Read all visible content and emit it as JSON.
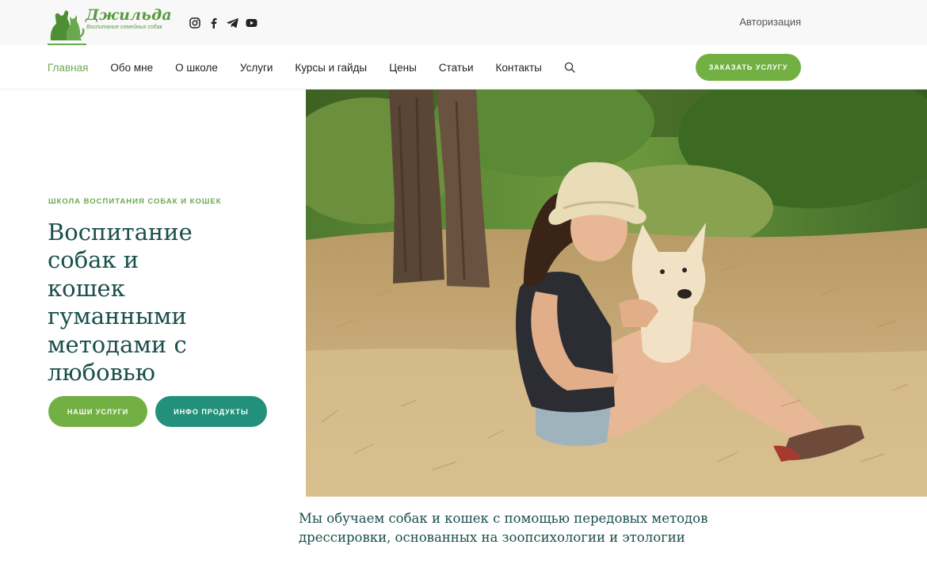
{
  "header": {
    "logo": {
      "name": "Джильда",
      "tagline": "Воспитание семейных собак"
    },
    "socials": [
      {
        "icon": "instagram-icon"
      },
      {
        "icon": "facebook-icon"
      },
      {
        "icon": "telegram-icon"
      },
      {
        "icon": "youtube-icon"
      }
    ],
    "auth_label": "Авторизация"
  },
  "nav": {
    "items": [
      {
        "label": "Главная",
        "active": true
      },
      {
        "label": "Обо мне"
      },
      {
        "label": "О школе"
      },
      {
        "label": "Услуги"
      },
      {
        "label": "Курсы и гайды"
      },
      {
        "label": "Цены"
      },
      {
        "label": "Статьи"
      },
      {
        "label": "Контакты"
      }
    ],
    "search_icon": "search-icon",
    "order_button": "ЗАКАЗАТЬ УСЛУГУ"
  },
  "hero": {
    "eyebrow": "ШКОЛА ВОСПИТАНИЯ СОБАК И КОШЕК",
    "title_lines": [
      "Воспитание",
      "собак и",
      "кошек",
      "гуманными",
      "методами с",
      "любовью"
    ],
    "buttons": {
      "services": "НАШИ УСЛУГИ",
      "info": "ИНФО ПРОДУКТЫ"
    }
  },
  "mission": {
    "lines": [
      "Мы обучаем собак и кошек с помощью передовых методов",
      "дрессировки, основанных на зоопсихологии и этологии"
    ]
  },
  "colors": {
    "accent_green": "#72b043",
    "teal": "#22907a",
    "heading": "#1a4f4a"
  }
}
